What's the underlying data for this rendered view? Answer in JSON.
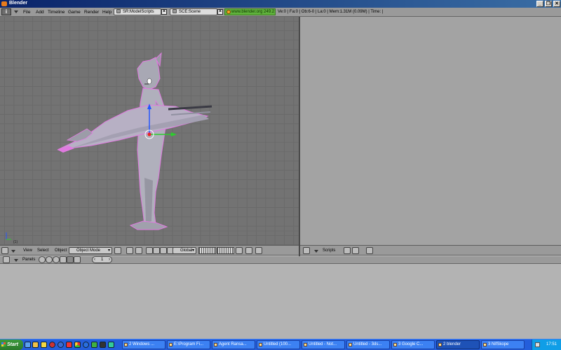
{
  "window": {
    "title": "Blender",
    "buttons": [
      "_",
      "❐",
      "✕"
    ]
  },
  "top_header": {
    "info_icon": "i",
    "menu": [
      "File",
      "Add",
      "Timeline",
      "Game",
      "Render",
      "Help"
    ],
    "screen_field": "SR:ModelScripts",
    "scene_field": "SCE:Scene",
    "url": "www.blender.org 249.2",
    "stats": "Ve:0 | Fa:0 | Ob:6-0 | La:0  | Mem:1.31M (0.09M)  | Time: |"
  },
  "viewport3d": {
    "frame_label": "(1)"
  },
  "viewport_header": {
    "menus": [
      "View",
      "Select",
      "Object"
    ],
    "mode": "Object Mode",
    "orientation": "Global"
  },
  "scripts_header": {
    "label": "Scripts"
  },
  "buttons_header": {
    "panels_label": "Panels",
    "frame_value": "1",
    "left_arrow": "‹",
    "right_arrow": "›"
  },
  "taskbar": {
    "start_label": "Start",
    "tasks": [
      {
        "label": "2 Windows ...",
        "active": false
      },
      {
        "label": "E:\\Program Fi...",
        "active": false
      },
      {
        "label": "Agent Ransa...",
        "active": false
      },
      {
        "label": "Untitled (100...",
        "active": false
      },
      {
        "label": "Untitled - Not...",
        "active": false
      },
      {
        "label": "Untitled - 3ds...",
        "active": false
      },
      {
        "label": "3 Google C...",
        "active": false
      },
      {
        "label": "2 blender",
        "active": true
      },
      {
        "label": "3 NifSkope",
        "active": false
      }
    ],
    "clock": "17:51"
  },
  "colors": {
    "viewport_bg": "#737373",
    "model_fill": "#a8a8b4",
    "selection_outline": "#e07ae0",
    "axis_x": "#2ecc2e",
    "axis_z": "#2255ff",
    "axis_origin": "#ee2222"
  }
}
